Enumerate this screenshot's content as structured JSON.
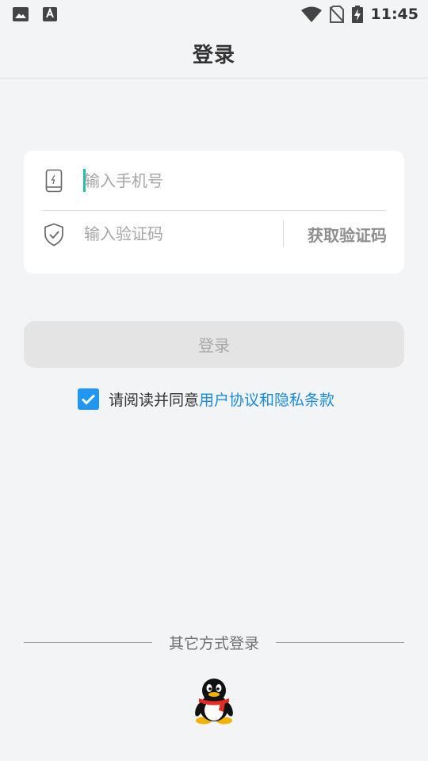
{
  "status_bar": {
    "time": "11:45"
  },
  "header": {
    "title": "登录"
  },
  "form": {
    "phone_placeholder": "输入手机号",
    "code_placeholder": "输入验证码",
    "get_code_label": "获取验证码"
  },
  "login_button": {
    "label": "登录"
  },
  "agreement": {
    "checked": true,
    "prefix": "请阅读并同意",
    "link": "用户协议和隐私条款"
  },
  "other_login": {
    "label": "其它方式登录",
    "options": [
      "qq-icon"
    ]
  },
  "colors": {
    "background": "#f3f4f6",
    "checkbox": "#2196f3",
    "link": "#1a8ce0",
    "caret": "#1bc5a4"
  }
}
